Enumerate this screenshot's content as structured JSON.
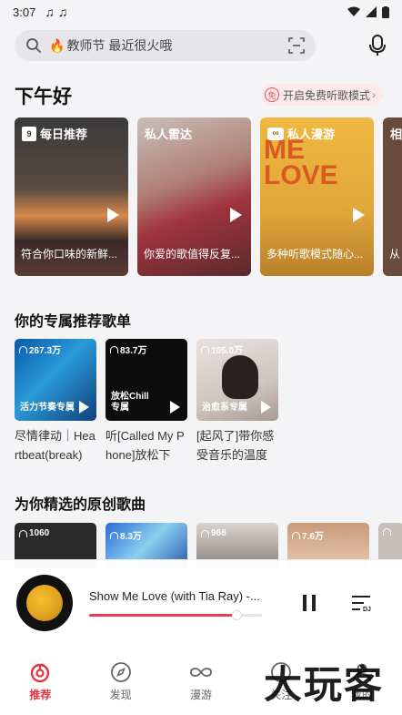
{
  "status_bar": {
    "time": "3:07"
  },
  "search": {
    "placeholder": "教师节 最近很火哦"
  },
  "greeting": "下午好",
  "free_mode": {
    "badge": "免",
    "label": "开启免费听歌模式"
  },
  "rec_cards": [
    {
      "title": "每日推荐",
      "desc": "符合你口味的新鲜...",
      "calendar_day": "9"
    },
    {
      "title": "私人雷达",
      "desc": "你爱的歌值得反复..."
    },
    {
      "title": "私人漫游",
      "desc": "多种听歌模式随心...",
      "cover_text": "ME LOVE",
      "icon_text": "∞"
    },
    {
      "title": "相",
      "desc": "从"
    }
  ],
  "playlists_section": {
    "title": "你的专属推荐歌单"
  },
  "playlists": [
    {
      "count": "267.3万",
      "cover_label": "活力节奏专属",
      "name": "尽情律动｜Heartbeat(break)"
    },
    {
      "count": "83.7万",
      "cover_label": "放松Chill\n专属",
      "name": "听[Called My Phone]放松下"
    },
    {
      "count": "105.0万",
      "cover_label": "治愈系专属",
      "name": "[起风了]带你感受音乐的温度"
    }
  ],
  "originals_section": {
    "title": "为你精选的原创歌曲"
  },
  "originals": [
    {
      "count": "1060"
    },
    {
      "count": "8.3万"
    },
    {
      "count": "968"
    },
    {
      "count": "7.6万"
    },
    {
      "count": ""
    }
  ],
  "player": {
    "song": "Show Me Love (with Tia Ray) -...",
    "progress": 0.85
  },
  "tabs": [
    {
      "label": "推荐",
      "active": true
    },
    {
      "label": "发现"
    },
    {
      "label": "漫游"
    },
    {
      "label": "关注"
    },
    {
      "label": "我的"
    }
  ],
  "watermark": "大玩客",
  "colors": {
    "accent": "#e8323f",
    "progress": "#f03a55"
  }
}
